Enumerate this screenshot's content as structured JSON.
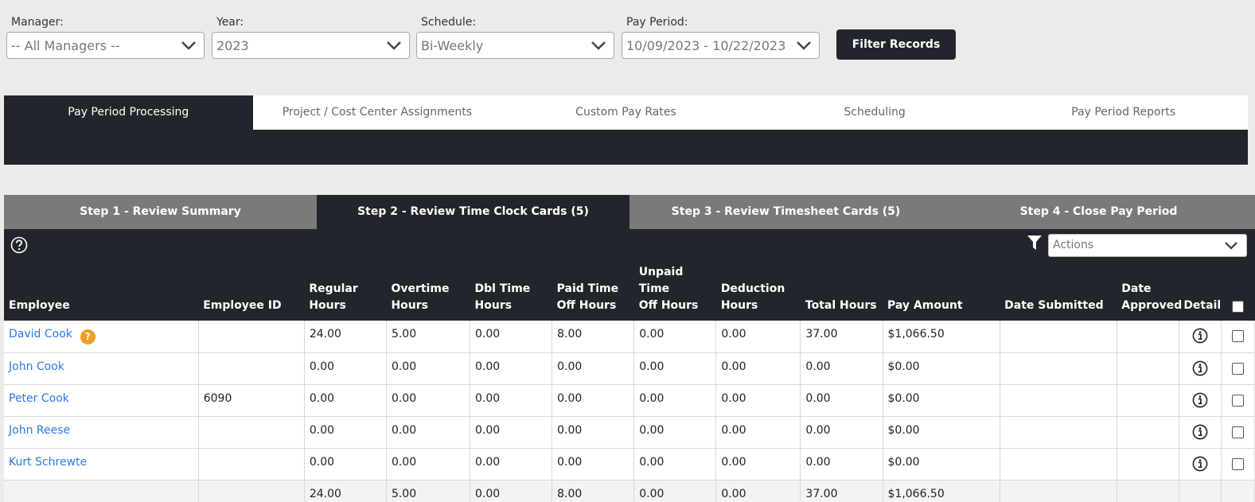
{
  "filters": {
    "manager": {
      "label": "Manager:",
      "value": "-- All Managers --"
    },
    "year": {
      "label": "Year:",
      "value": "2023"
    },
    "schedule": {
      "label": "Schedule:",
      "value": "Bi-Weekly"
    },
    "pay_period": {
      "label": "Pay Period:",
      "value": "10/09/2023 - 10/22/2023"
    },
    "filter_button": "Filter Records"
  },
  "main_tabs": [
    {
      "label": "Pay Period Processing",
      "active": true
    },
    {
      "label": "Project / Cost Center Assignments",
      "active": false
    },
    {
      "label": "Custom Pay Rates",
      "active": false
    },
    {
      "label": "Scheduling",
      "active": false
    },
    {
      "label": "Pay Period Reports",
      "active": false
    }
  ],
  "steps": [
    {
      "label": "Step 1 - Review Summary",
      "active": false
    },
    {
      "label": "Step 2 - Review Time Clock Cards (5)",
      "active": true
    },
    {
      "label": "Step 3 - Review Timesheet Cards (5)",
      "active": false
    },
    {
      "label": "Step 4 - Close Pay Period",
      "active": false
    }
  ],
  "toolbar": {
    "actions_placeholder": "Actions"
  },
  "columns": {
    "employee": "Employee",
    "employee_id": "Employee ID",
    "regular_1": "Regular",
    "regular_2": "Hours",
    "overtime_1": "Overtime",
    "overtime_2": "Hours",
    "dbl_1": "Dbl Time",
    "dbl_2": "Hours",
    "pto_1": "Paid Time",
    "pto_2": "Off Hours",
    "unpaid_1": "Unpaid Time",
    "unpaid_2": "Off Hours",
    "deduction_1": "Deduction",
    "deduction_2": "Hours",
    "total": "Total Hours",
    "pay": "Pay Amount",
    "submitted": "Date Submitted",
    "approved_1": "Date",
    "approved_2": "Approved",
    "detail": "Detail"
  },
  "rows": [
    {
      "employee": "David Cook",
      "badge": "?",
      "employee_id": "",
      "regular": "24.00",
      "overtime": "5.00",
      "dbl": "0.00",
      "pto": "8.00",
      "unpaid": "0.00",
      "deduction": "0.00",
      "total": "37.00",
      "pay": "$1,066.50",
      "submitted": "",
      "approved": ""
    },
    {
      "employee": "John Cook",
      "employee_id": "",
      "regular": "0.00",
      "overtime": "0.00",
      "dbl": "0.00",
      "pto": "0.00",
      "unpaid": "0.00",
      "deduction": "0.00",
      "total": "0.00",
      "pay": "$0.00",
      "submitted": "",
      "approved": ""
    },
    {
      "employee": "Peter Cook",
      "employee_id": "6090",
      "regular": "0.00",
      "overtime": "0.00",
      "dbl": "0.00",
      "pto": "0.00",
      "unpaid": "0.00",
      "deduction": "0.00",
      "total": "0.00",
      "pay": "$0.00",
      "submitted": "",
      "approved": ""
    },
    {
      "employee": "John Reese",
      "employee_id": "",
      "regular": "0.00",
      "overtime": "0.00",
      "dbl": "0.00",
      "pto": "0.00",
      "unpaid": "0.00",
      "deduction": "0.00",
      "total": "0.00",
      "pay": "$0.00",
      "submitted": "",
      "approved": ""
    },
    {
      "employee": "Kurt Schrewte",
      "employee_id": "",
      "regular": "0.00",
      "overtime": "0.00",
      "dbl": "0.00",
      "pto": "0.00",
      "unpaid": "0.00",
      "deduction": "0.00",
      "total": "0.00",
      "pay": "$0.00",
      "submitted": "",
      "approved": ""
    }
  ],
  "totals": {
    "regular": "24.00",
    "overtime": "5.00",
    "dbl": "0.00",
    "pto": "8.00",
    "unpaid": "0.00",
    "deduction": "0.00",
    "total": "37.00",
    "pay": "$1,066.50"
  },
  "icons": {
    "help": "help-circle-icon",
    "filter": "filter-funnel-icon",
    "detail": "info-circle-icon",
    "badge": "question-badge-icon"
  },
  "colors": {
    "dark": "#22252b",
    "link": "#2a7ae2",
    "badge": "#f0a020",
    "step_inactive": "#7a7a7a"
  }
}
